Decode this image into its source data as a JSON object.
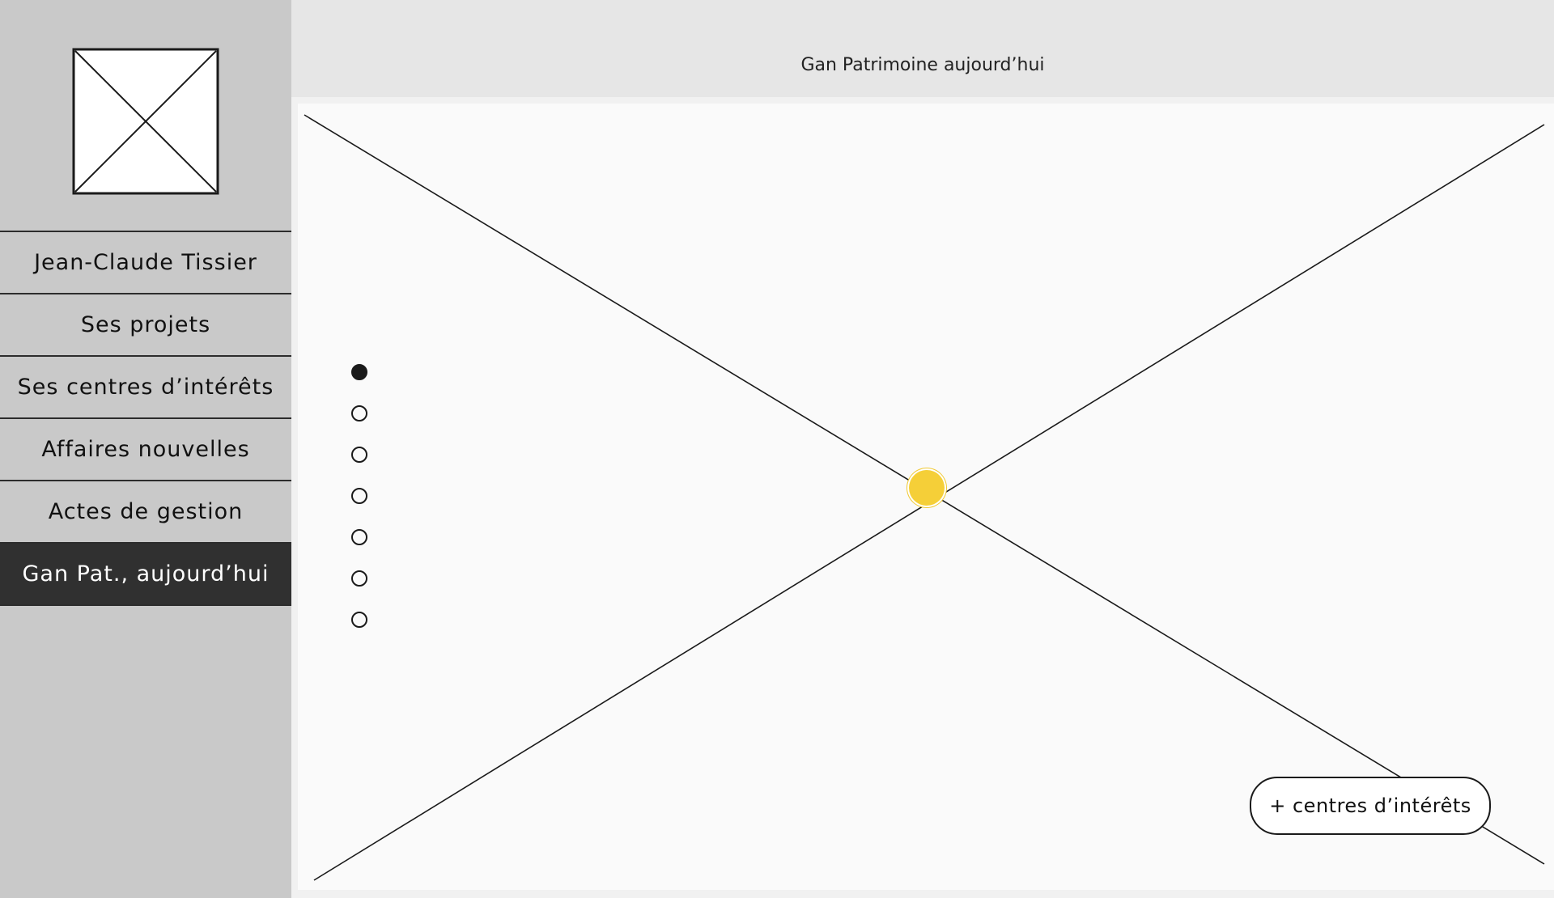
{
  "header": {
    "title": "Gan Patrimoine aujourd’hui"
  },
  "sidebar": {
    "logo_icon": "image-placeholder-icon",
    "items": [
      {
        "label": "Jean-Claude Tissier",
        "active": false
      },
      {
        "label": "Ses projets",
        "active": false
      },
      {
        "label": "Ses centres d’intérêts",
        "active": false
      },
      {
        "label": "Affaires nouvelles",
        "active": false
      },
      {
        "label": "Actes de gestion",
        "active": false
      },
      {
        "label": "Gan Pat., aujourd’hui",
        "active": true
      }
    ]
  },
  "main": {
    "placeholder_icon": "image-placeholder-icon",
    "carousel": {
      "count": 7,
      "active_index": 0
    },
    "hotspot_color": "#f5cf38",
    "add_button_label": "+ centres d’intérêts"
  },
  "colors": {
    "sidebar_bg": "#c9c9c9",
    "active_item_bg": "#303030",
    "header_bg": "#e6e6e6",
    "canvas_bg": "#fafafa"
  }
}
